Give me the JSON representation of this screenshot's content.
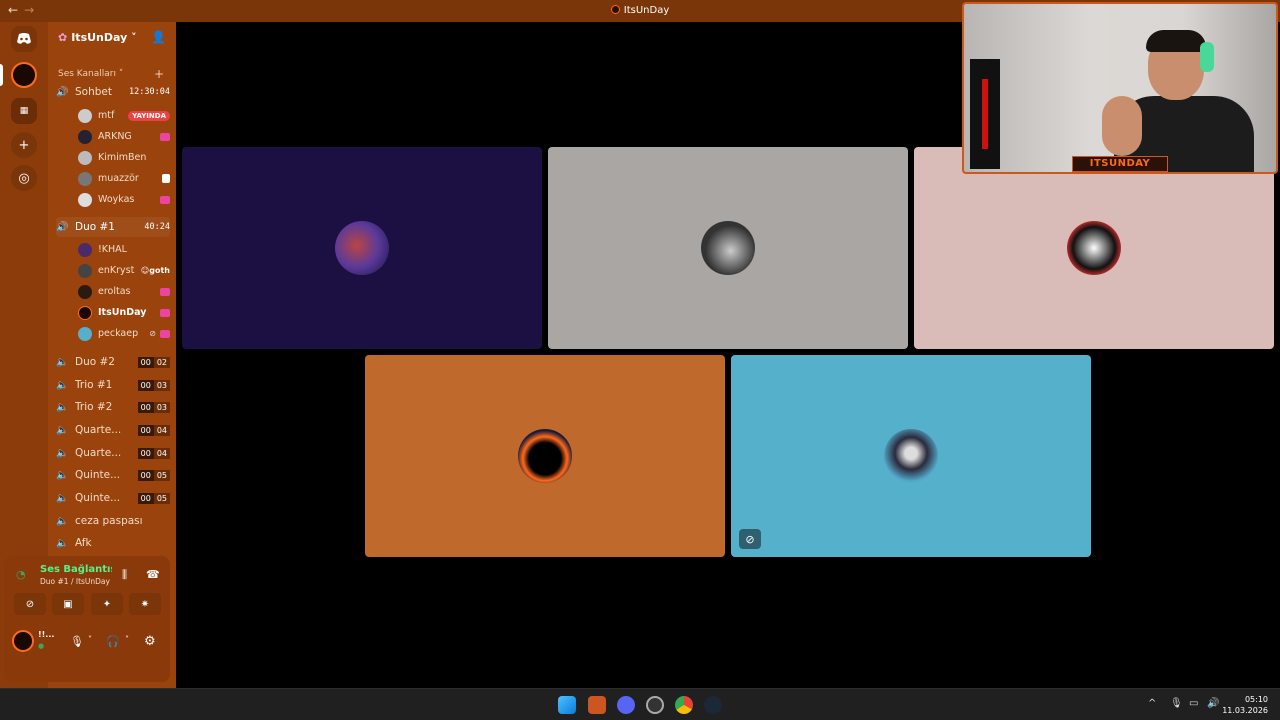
{
  "window": {
    "title": "ItsUnDay",
    "nav_back": "←",
    "nav_forward": "→"
  },
  "server": {
    "name": "ItsUnDay",
    "chevron": "˅"
  },
  "category": {
    "label": "Ses Kanalları",
    "chevron": "˅",
    "add": "+"
  },
  "channels": [
    {
      "name": "Sohbet",
      "timer": "12:30:04"
    },
    {
      "name": "Duo #1",
      "timer": "40:24"
    },
    {
      "name": "Duo #2",
      "count": [
        "00",
        "02"
      ]
    },
    {
      "name": "Trio #1",
      "count": [
        "00",
        "03"
      ]
    },
    {
      "name": "Trio #2",
      "count": [
        "00",
        "03"
      ]
    },
    {
      "name": "Quarte...",
      "count": [
        "00",
        "04"
      ]
    },
    {
      "name": "Quarte...",
      "count": [
        "00",
        "04"
      ]
    },
    {
      "name": "Quinte...",
      "count": [
        "00",
        "05"
      ]
    },
    {
      "name": "Quinte...",
      "count": [
        "00",
        "05"
      ]
    },
    {
      "name": "ceza paspası"
    },
    {
      "name": "Afk"
    }
  ],
  "sohbet_users": [
    {
      "name": "mtf",
      "badge": "YAYINDA"
    },
    {
      "name": "ARKNG"
    },
    {
      "name": "KimimBen"
    },
    {
      "name": "muazzör"
    },
    {
      "name": "Woykas"
    }
  ],
  "duo_users": [
    {
      "name": "!KHAL"
    },
    {
      "name": "enKryst",
      "tag": "goth"
    },
    {
      "name": "eroltas"
    },
    {
      "name": "ItsUnDay"
    },
    {
      "name": "peckaep"
    }
  ],
  "voice_panel": {
    "status": "Ses Bağlantısı K",
    "location": "Duo #1 / ItsUnDay",
    "user_short": "!!..."
  },
  "stream_overlay": {
    "brand": "ITSUNDAY"
  },
  "clock": {
    "time": "05:10",
    "date": "11.03.2026"
  },
  "colors": {
    "rail": "#8c3c0a",
    "sidebar": "#9a430c",
    "titlebar": "#7a3508",
    "tile_1": "#1c0f42",
    "tile_2": "#aaa6a3",
    "tile_3": "#d9bbb7",
    "tile_4": "#c0692d",
    "tile_5": "#55b0cc",
    "live": "#ed4245",
    "voice_green": "#3ba55d"
  }
}
